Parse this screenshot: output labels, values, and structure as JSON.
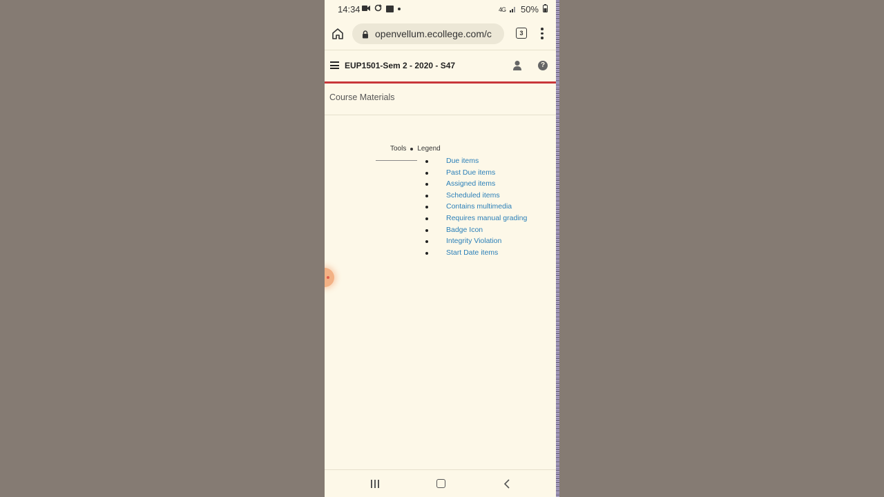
{
  "status_bar": {
    "time": "14:34",
    "battery": "50%",
    "network": "4G"
  },
  "browser": {
    "url": "openvellum.ecollege.com/c",
    "tab_count": "3",
    "icons": [
      "home-icon",
      "lock-icon",
      "tabs-icon",
      "more-vert-icon"
    ]
  },
  "header": {
    "course_title": "EUP1501-Sem 2 - 2020 - S47",
    "icons": [
      "menu-icon",
      "user-icon",
      "help-icon"
    ],
    "help_glyph": "?"
  },
  "page": {
    "section_title": "Course Materials"
  },
  "tools": {
    "tools_label": "Tools",
    "legend_label": "Legend",
    "legend_items": [
      {
        "label": "Due items"
      },
      {
        "label": "Past Due items"
      },
      {
        "label": "Assigned items"
      },
      {
        "label": "Scheduled items"
      },
      {
        "label": "Contains multimedia"
      },
      {
        "label": "Requires manual grading"
      },
      {
        "label": "Badge Icon"
      },
      {
        "label": "Integrity Violation"
      },
      {
        "label": "Start Date items"
      }
    ]
  },
  "colors": {
    "accent_red": "#c8363a",
    "link_blue": "#2a7fb8",
    "page_bg": "#fdf8e8"
  },
  "system_nav": {
    "icons": [
      "recents-icon",
      "home-nav-icon",
      "back-icon"
    ]
  }
}
